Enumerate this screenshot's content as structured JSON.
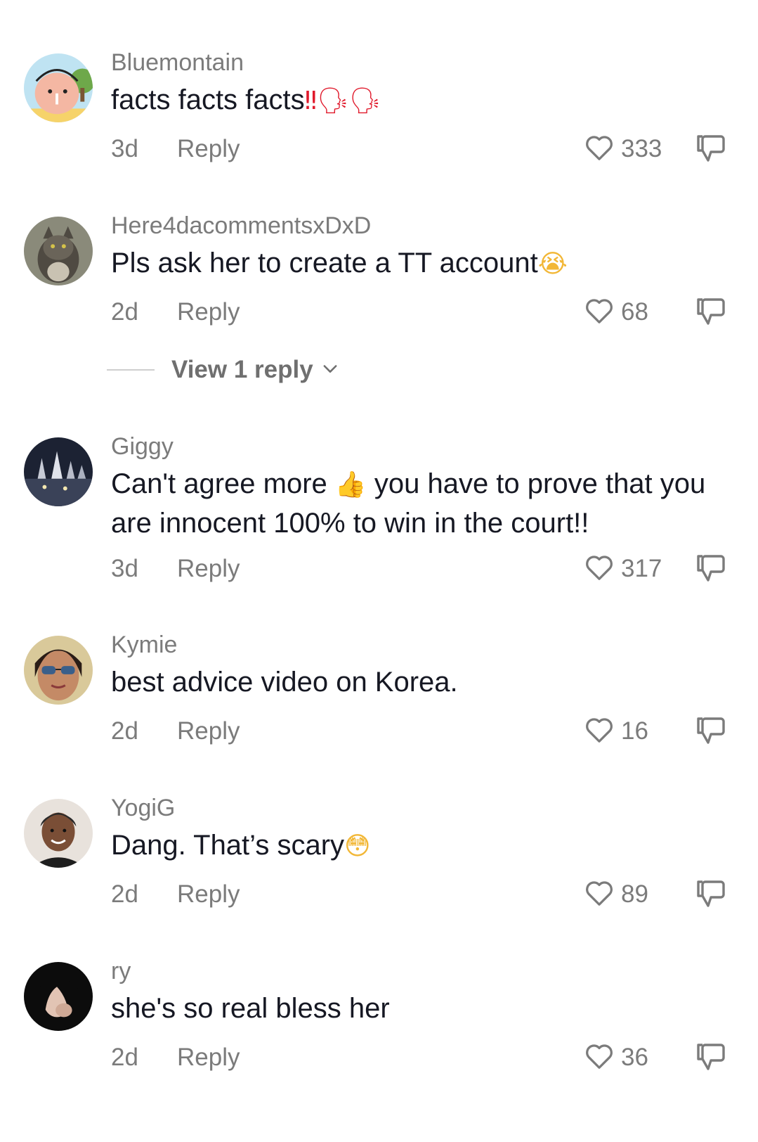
{
  "comments": [
    {
      "username": "Bluemontain",
      "text": "facts facts facts",
      "text_suffix": "‼🗣🗣",
      "time": "3d",
      "reply": "Reply",
      "likes": "333"
    },
    {
      "username": "Here4dacommentsxDxD",
      "text": "Pls ask her to create a TT account",
      "text_suffix": "😭",
      "time": "2d",
      "reply": "Reply",
      "likes": "68",
      "view_replies": "View 1 reply"
    },
    {
      "username": "Giggy",
      "text_part1": "Can't agree more ",
      "text_emoji": "👍",
      "text_part2": " you have to prove that you are innocent 100% to win in the court!!",
      "time": "3d",
      "reply": "Reply",
      "likes": "317"
    },
    {
      "username": "Kymie",
      "text": "best advice video on Korea.",
      "time": "2d",
      "reply": "Reply",
      "likes": "16"
    },
    {
      "username": "YogiG",
      "text": "Dang. That’s scary",
      "text_suffix": "😳",
      "time": "2d",
      "reply": "Reply",
      "likes": "89"
    },
    {
      "username": "ry",
      "text": "she's so real bless her",
      "time": "2d",
      "reply": "Reply",
      "likes": "36"
    }
  ],
  "icons": {
    "like": "heart-outline-icon",
    "dislike": "thumbs-down-icon",
    "expand": "chevron-down-icon"
  },
  "colors": {
    "text": "#161823",
    "secondary": "#7b7b7b",
    "accent": "#e0192b"
  }
}
